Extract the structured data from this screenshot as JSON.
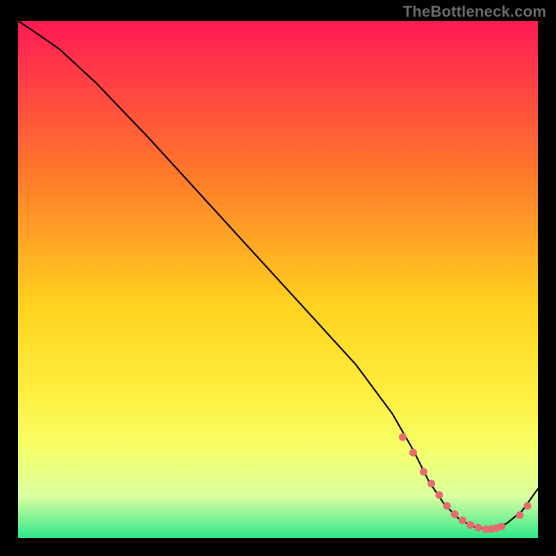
{
  "watermark": "TheBottleneck.com",
  "colors": {
    "black": "#000000",
    "curve": "#000000",
    "dot": "#e66a6f",
    "grad_top": "#ff1a55",
    "grad_mid1": "#ff7a2a",
    "grad_mid2": "#ffd21f",
    "grad_mid3": "#ffef3f",
    "grad_mid4": "#f6ff6a",
    "grad_mid5": "#d9ffa0",
    "grad_bottom": "#2ee88b"
  },
  "chart_data": {
    "type": "line",
    "title": "",
    "xlabel": "",
    "ylabel": "",
    "xlim": [
      0,
      100
    ],
    "ylim": [
      0,
      100
    ],
    "series": [
      {
        "name": "bottleneck-curve",
        "x": [
          0,
          3,
          8,
          15,
          25,
          35,
          45,
          55,
          65,
          72,
          76,
          79,
          82,
          85,
          88,
          91,
          94,
          97,
          100
        ],
        "y": [
          100,
          98,
          94.5,
          88,
          77.5,
          66.5,
          55.5,
          44.5,
          33.5,
          24,
          17,
          11,
          6.5,
          3.5,
          2.0,
          1.7,
          2.8,
          5.3,
          9.5
        ]
      }
    ],
    "marker_points": {
      "name": "highlighted-range",
      "x": [
        74,
        76,
        78,
        79.5,
        81,
        82.5,
        84,
        85.5,
        87,
        88.5,
        90,
        91,
        92,
        93,
        96.5,
        98
      ],
      "y": [
        19.5,
        16.5,
        12.8,
        10.5,
        8.3,
        6.2,
        4.6,
        3.4,
        2.5,
        2.0,
        1.7,
        1.7,
        1.9,
        2.2,
        4.4,
        6.2
      ]
    }
  }
}
